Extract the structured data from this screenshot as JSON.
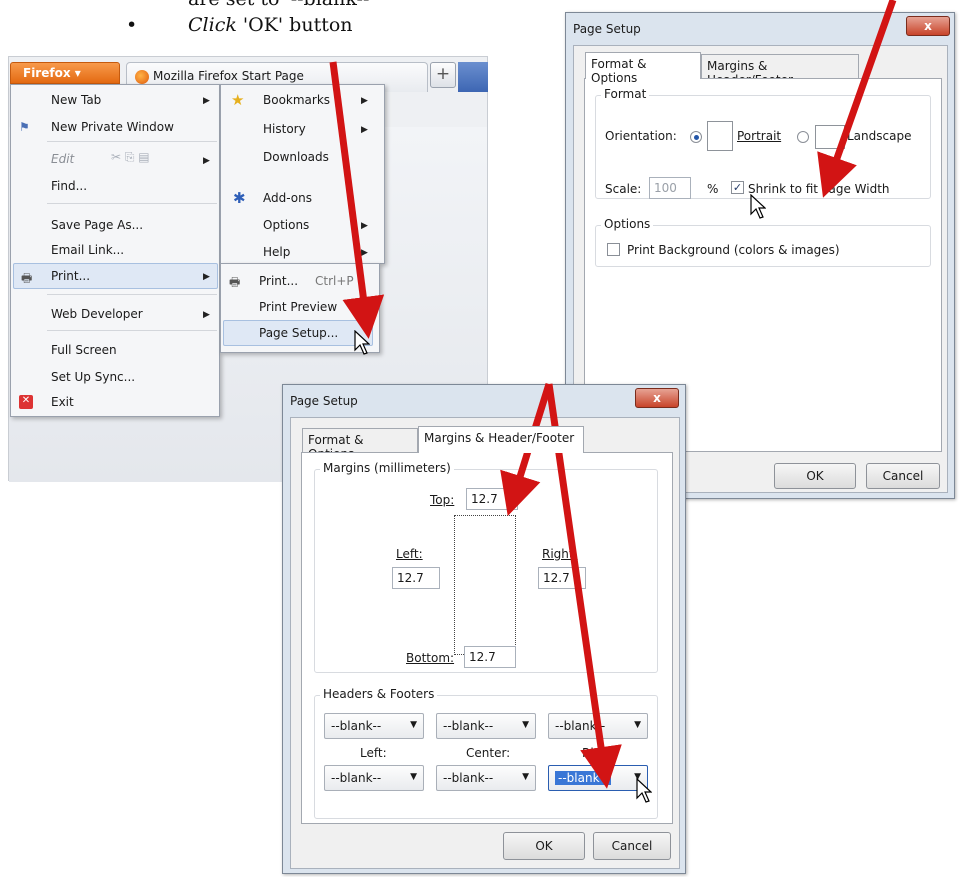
{
  "instructions": {
    "line1": "are set to '--blank--'",
    "line2_verb": "Click",
    "line2_rest": "'OK' button"
  },
  "firefox": {
    "button_label": "Firefox",
    "tab_title": "Mozilla Firefox Start Page",
    "plus_label": "+"
  },
  "menu_left": {
    "new_tab": "New Tab",
    "new_private_window": "New Private Window",
    "edit": "Edit",
    "find": "Find...",
    "save_page_as": "Save Page As...",
    "email_link": "Email Link...",
    "print": "Print...",
    "web_developer": "Web Developer",
    "full_screen": "Full Screen",
    "set_up_sync": "Set Up Sync...",
    "exit": "Exit"
  },
  "menu_right": {
    "bookmarks": "Bookmarks",
    "history": "History",
    "downloads": "Downloads",
    "add_ons": "Add-ons",
    "options": "Options",
    "help": "Help"
  },
  "print_submenu": {
    "print": "Print...",
    "print_shortcut": "Ctrl+P",
    "print_preview": "Print Preview",
    "page_setup": "Page Setup..."
  },
  "dialog1": {
    "title": "Page Setup",
    "close": "x",
    "tabs": [
      "Format & Options",
      "Margins & Header/Footer"
    ],
    "format_group": "Format",
    "orientation_label": "Orientation:",
    "portrait": "Portrait",
    "landscape": "Landscape",
    "scale_label": "Scale:",
    "scale_value": "100",
    "percent": "%",
    "shrink_label": "Shrink to fit Page Width",
    "options_group": "Options",
    "print_background": "Print Background (colors & images)",
    "ok": "OK",
    "cancel": "Cancel"
  },
  "dialog2": {
    "title": "Page Setup",
    "close": "x",
    "tabs": [
      "Format & Options",
      "Margins & Header/Footer"
    ],
    "margins_group": "Margins (millimeters)",
    "top_label": "Top:",
    "top_value": "12.7",
    "left_label": "Left:",
    "left_value": "12.7",
    "right_label": "Right:",
    "right_value": "12.7",
    "bottom_label": "Bottom:",
    "bottom_value": "12.7",
    "hf_group": "Headers & Footers",
    "header_left": "--blank--",
    "header_center": "--blank--",
    "header_right": "--blank--",
    "col_left": "Left:",
    "col_center": "Center:",
    "col_right": "Right:",
    "footer_left": "--blank--",
    "footer_center": "--blank--",
    "footer_right": "--blank--",
    "ok": "OK",
    "cancel": "Cancel"
  },
  "colors": {
    "arrow": "#d21414",
    "firefox_orange": "#e46a12",
    "selection_blue": "#3a77d6"
  }
}
